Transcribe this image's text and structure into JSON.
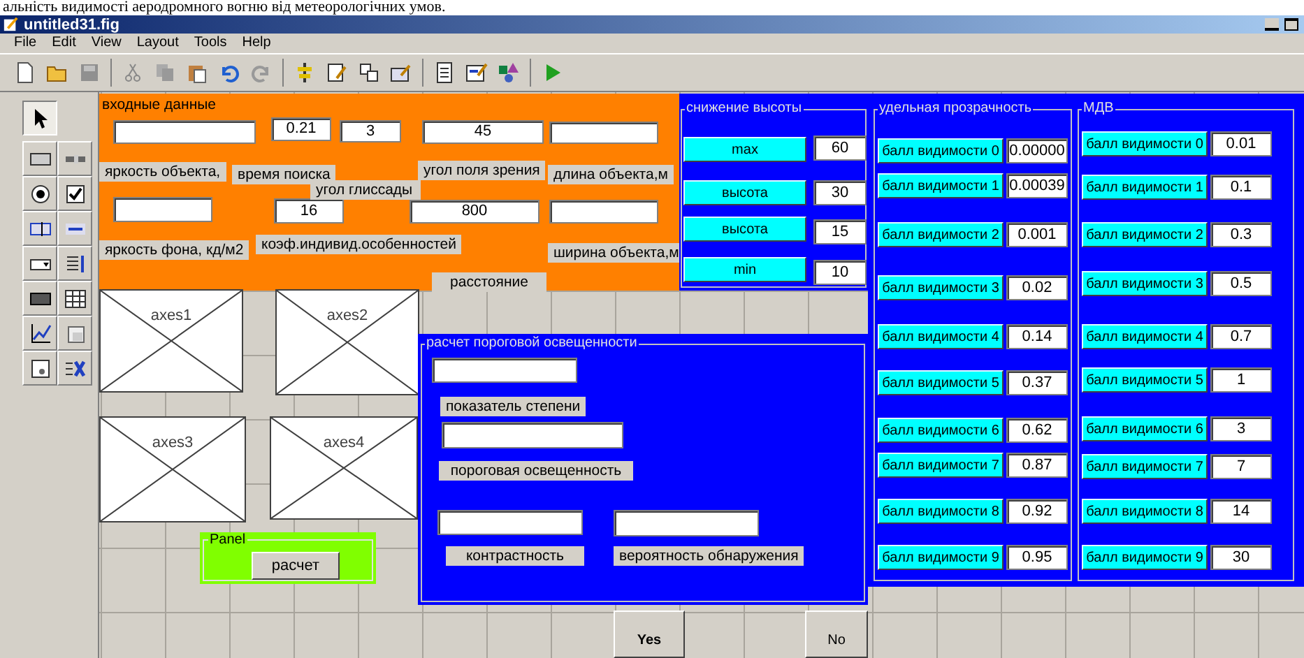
{
  "document_text": "альність видимості аеродромного вогню від метеорологічних умов.",
  "window": {
    "title": "untitled31.fig"
  },
  "menu": [
    "File",
    "Edit",
    "View",
    "Layout",
    "Tools",
    "Help"
  ],
  "palette": [
    {
      "selected": true
    },
    {
      "selected": false
    },
    {
      "selected": false
    },
    {
      "selected": false
    },
    {
      "selected": false
    },
    {
      "selected": false
    },
    {
      "selected": false
    },
    {
      "selected": false
    },
    {
      "selected": false
    },
    {
      "selected": false
    },
    {
      "selected": false
    },
    {
      "selected": false
    },
    {
      "selected": false
    },
    {
      "selected": false
    },
    {
      "selected": false
    }
  ],
  "input_panel": {
    "title": "входные данные",
    "fields": [
      "0.21",
      "3",
      "45",
      "16",
      "800"
    ],
    "labels": [
      "яркость объекта,",
      "время поиска",
      "угол поля зрения",
      "длина объекта,м",
      "угол глиссады",
      "яркость фона, кд/м2",
      "коэф.индивид.особенностей",
      "ширина объекта,м",
      "расстояние"
    ]
  },
  "descent_panel": {
    "title": "снижение высоты",
    "rows": [
      {
        "label": "max",
        "value": "60"
      },
      {
        "label": "высота",
        "value": "30"
      },
      {
        "label": "высота",
        "value": "15"
      },
      {
        "label": "min",
        "value": "10"
      }
    ]
  },
  "transparency_panel": {
    "title": "удельная прозрачность",
    "rows": [
      {
        "label": "балл видимости 0",
        "value": "0.00000"
      },
      {
        "label": "балл видимости 1",
        "value": "0.00039"
      },
      {
        "label": "балл видимости 2",
        "value": "0.001"
      },
      {
        "label": "балл видимости 3",
        "value": "0.02"
      },
      {
        "label": "балл видимости 4",
        "value": "0.14"
      },
      {
        "label": "балл видимости 5",
        "value": "0.37"
      },
      {
        "label": "балл видимости 6",
        "value": "0.62"
      },
      {
        "label": "балл видимости 7",
        "value": "0.87"
      },
      {
        "label": "балл видимости 8",
        "value": "0.92"
      },
      {
        "label": "балл видимости 9",
        "value": "0.95"
      }
    ]
  },
  "mdv_panel": {
    "title": "МДВ",
    "rows": [
      {
        "label": "балл видимости 0",
        "value": "0.01"
      },
      {
        "label": "балл видимости 1",
        "value": "0.1"
      },
      {
        "label": "балл видимости 2",
        "value": "0.3"
      },
      {
        "label": "балл видимости 3",
        "value": "0.5"
      },
      {
        "label": "балл видимости 4",
        "value": "0.7"
      },
      {
        "label": "балл видимости 5",
        "value": "1"
      },
      {
        "label": "балл видимости 6",
        "value": "3"
      },
      {
        "label": "балл видимости 7",
        "value": "7"
      },
      {
        "label": "балл видимости 8",
        "value": "14"
      },
      {
        "label": "балл видимости 9",
        "value": "30"
      }
    ]
  },
  "threshold_panel": {
    "title": "расчет пороговой освещенности",
    "labels": [
      "показатель степени",
      "пороговая освещенность",
      "контрастность",
      "вероятность обнаружения"
    ]
  },
  "axes": [
    "axes1",
    "axes2",
    "axes3",
    "axes4"
  ],
  "button_panel": {
    "title": "Panel",
    "button": "расчет"
  },
  "buttons": [
    "Yes",
    "No"
  ]
}
